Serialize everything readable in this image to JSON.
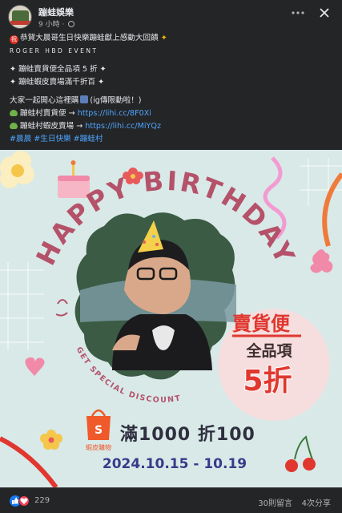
{
  "header": {
    "page_name": "蹦蛙娛樂",
    "time": "9 小時",
    "more_icon": "more-icon",
    "close_icon": "close-icon"
  },
  "post": {
    "line1": "恭賀大晨哥生日快樂蹦蛙獻上感動大回饋",
    "line2": "ROGER HBD EVENT",
    "line3": "✦ 蹦蛙賣貨便全品項 5 折 ✦",
    "line4": "✦ 蹦蛙蝦皮賣場滿千折百 ✦",
    "line5a": "大家一起開心這裡購",
    "line5b": "(ig傳限動啦！)",
    "line6_label": "蹦蛙村賣貨便 → ",
    "line6_link": "https://lihi.cc/8F0Xi",
    "line7_label": "蹦蛙村蝦皮賣場 → ",
    "line7_link": "https://lihi.cc/MiYQz",
    "hashtags": [
      "#晨晨",
      "#生日快樂",
      "#蹦蛙村"
    ]
  },
  "banner": {
    "headline": "HAPPY BIRTHDAY",
    "subline": "GET SPECIAL DISCOUNT",
    "shop1_name": "賣貨便",
    "shop1_offer": "全品項",
    "shop1_discount": "5折",
    "shop2_logo": "蝦皮購物",
    "shop2_offer": "滿1000 折100",
    "dates": "2024.10.15 - 10.19",
    "colors": {
      "background": "#d8e9e8",
      "headline": "#b5526a",
      "accent_red": "#e0372f",
      "shopee": "#f0592a",
      "circle": "#f6dede"
    }
  },
  "footer": {
    "reactions": "229",
    "comments": "30則留言",
    "shares": "4次分享"
  }
}
